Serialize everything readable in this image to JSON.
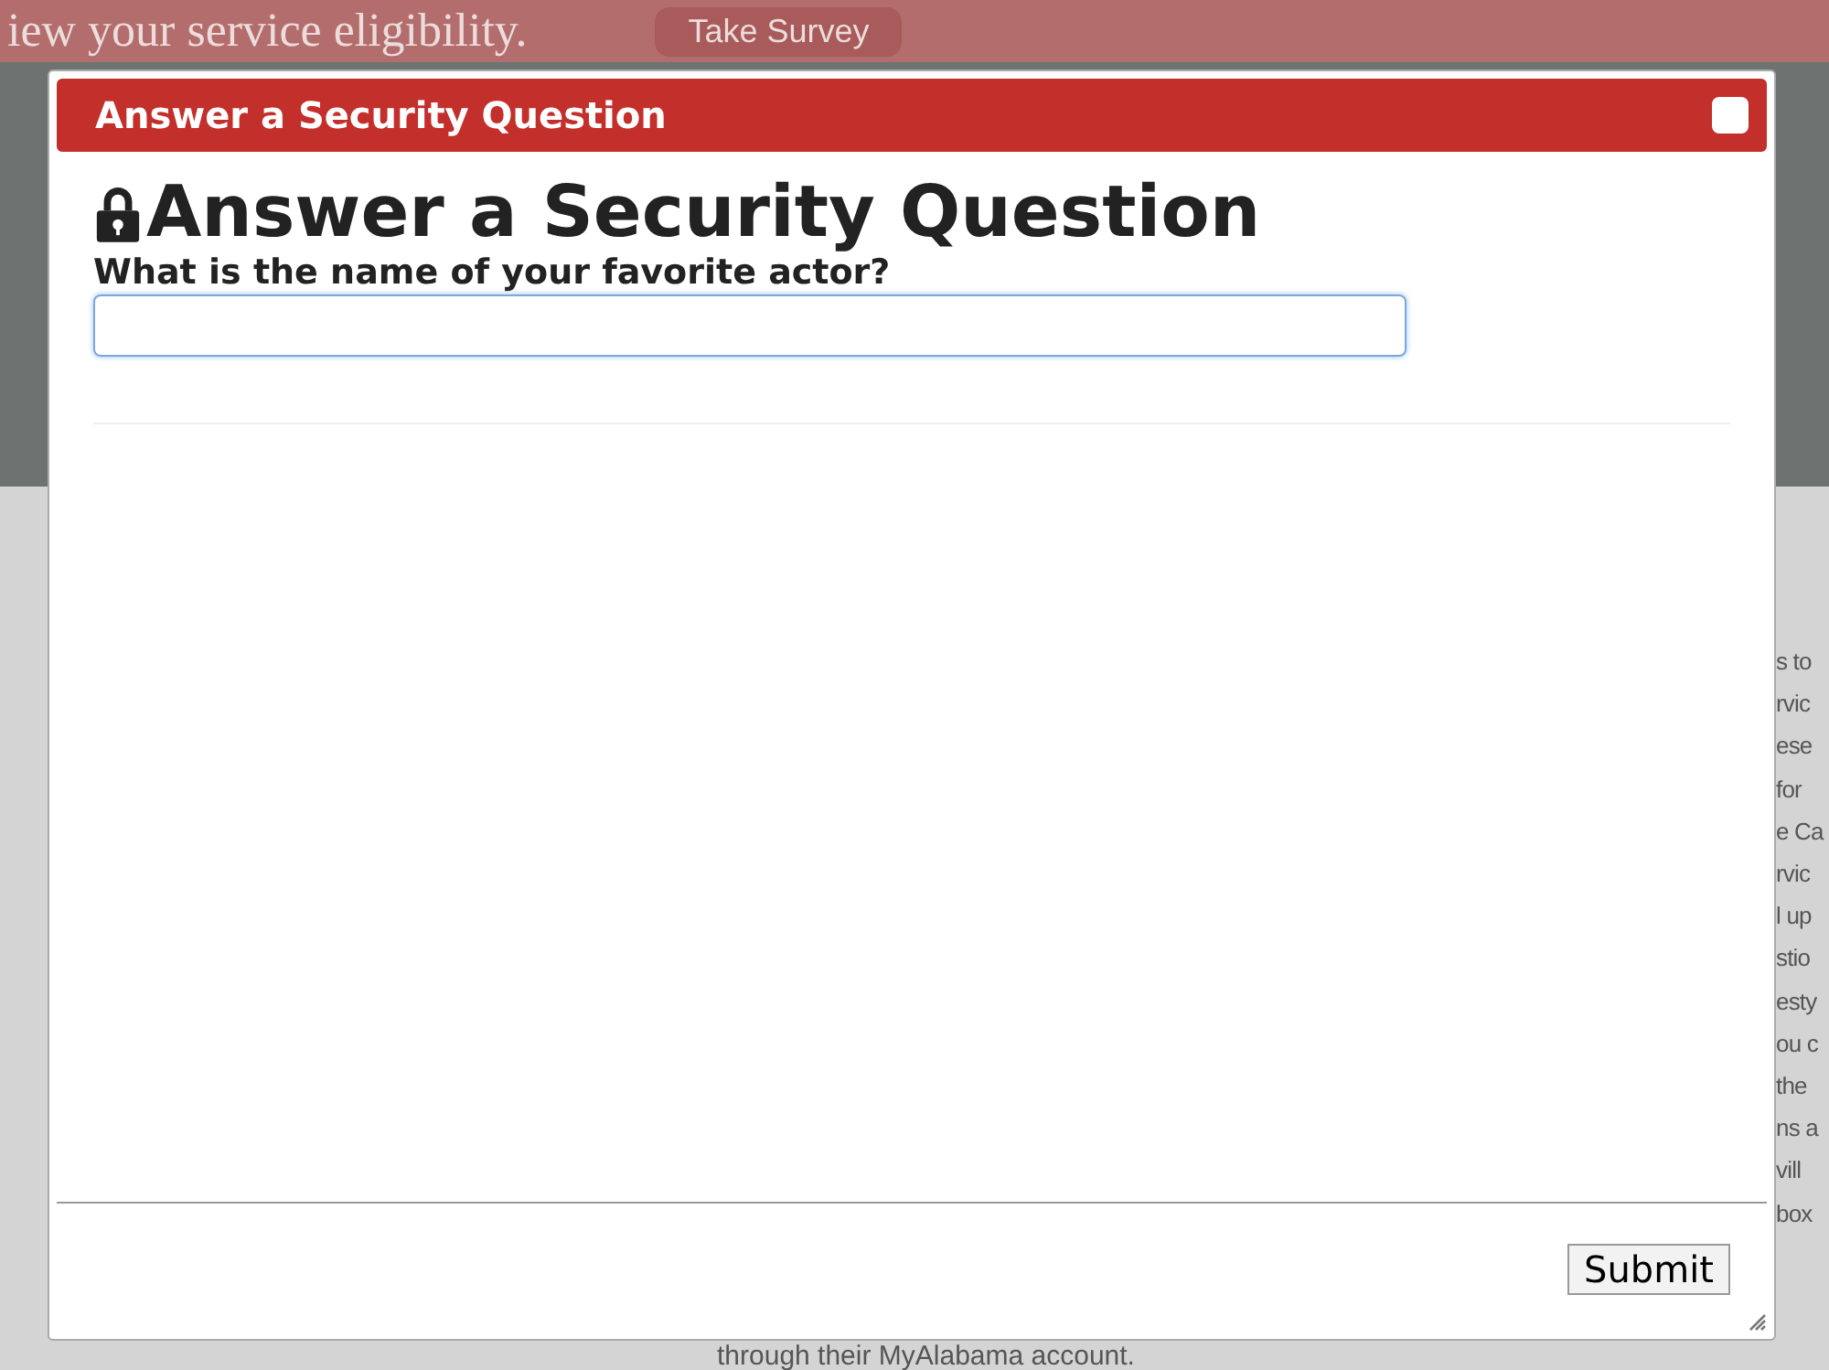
{
  "banner": {
    "text": "iew your service eligibility.",
    "button": "Take Survey"
  },
  "background": {
    "right_fragments": [
      "s to",
      "rvic",
      "ese",
      "for",
      "e Ca",
      "rvic",
      "l up",
      "stio",
      "esty",
      "ou c",
      "the",
      "ns a",
      "vill",
      "box"
    ],
    "footer_text": "through their MyAlabama account."
  },
  "dialog": {
    "title": "Answer a Security Question",
    "heading": "Answer a Security Question",
    "question": "What is the name of your favorite actor?",
    "submit": "Submit"
  }
}
